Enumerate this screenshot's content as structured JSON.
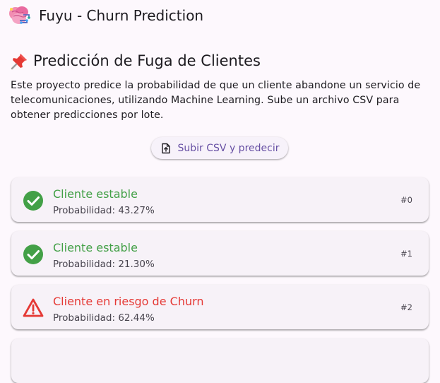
{
  "app": {
    "title": "Fuyu - Churn Prediction",
    "logo_icon": "brain-icon"
  },
  "page": {
    "title_icon": "pushpin-icon",
    "title": "Predicción de Fuga de Clientes",
    "description": "Este proyecto predice la probabilidad de que un cliente abandone un servicio de telecomunicaciones, utilizando Machine Learning. Sube un archivo CSV para obtener predicciones por lote."
  },
  "upload_button": {
    "label": "Subir CSV y predecir",
    "icon": "file-upload-icon"
  },
  "colors": {
    "accent": "#6750a4",
    "stable": "#43a047",
    "risk": "#e53935",
    "background": "#fdf8fd",
    "card": "#f7f2f8"
  },
  "results": [
    {
      "status": "stable",
      "icon": "check-circle-icon",
      "title": "Cliente estable",
      "probability": "Probabilidad: 43.27%",
      "index": "#0"
    },
    {
      "status": "stable",
      "icon": "check-circle-icon",
      "title": "Cliente estable",
      "probability": "Probabilidad: 21.30%",
      "index": "#1"
    },
    {
      "status": "risk",
      "icon": "warning-triangle-icon",
      "title": "Cliente en riesgo de Churn",
      "probability": "Probabilidad: 62.44%",
      "index": "#2"
    }
  ]
}
